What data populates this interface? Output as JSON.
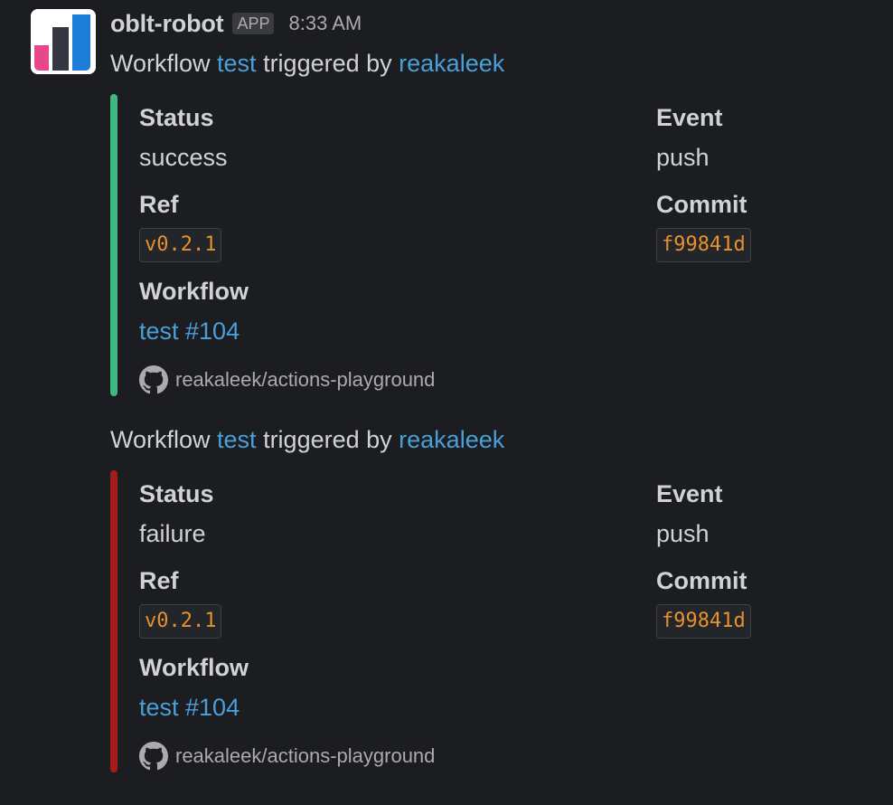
{
  "message": {
    "bot_name": "oblt-robot",
    "app_badge": "APP",
    "timestamp": "8:33 AM"
  },
  "colors": {
    "success": "#3fb883",
    "failure": "#a51c1c",
    "link": "#4a9fd8",
    "code": "#e8912d"
  },
  "attachments": [
    {
      "intro": {
        "prefix": "Workflow ",
        "workflow_link": "test",
        "middle": " triggered by ",
        "user_link": "reakaleek"
      },
      "color": "success",
      "fields": {
        "status_title": "Status",
        "status_value": "success",
        "event_title": "Event",
        "event_value": "push",
        "ref_title": "Ref",
        "ref_value": "v0.2.1",
        "commit_title": "Commit",
        "commit_value": "f99841d",
        "workflow_title": "Workflow",
        "workflow_value": "test #104"
      },
      "footer": {
        "icon": "github-icon",
        "text": "reakaleek/actions-playground"
      }
    },
    {
      "intro": {
        "prefix": "Workflow ",
        "workflow_link": "test",
        "middle": " triggered by ",
        "user_link": "reakaleek"
      },
      "color": "failure",
      "fields": {
        "status_title": "Status",
        "status_value": "failure",
        "event_title": "Event",
        "event_value": "push",
        "ref_title": "Ref",
        "ref_value": "v0.2.1",
        "commit_title": "Commit",
        "commit_value": "f99841d",
        "workflow_title": "Workflow",
        "workflow_value": "test #104"
      },
      "footer": {
        "icon": "github-icon",
        "text": "reakaleek/actions-playground"
      }
    }
  ]
}
